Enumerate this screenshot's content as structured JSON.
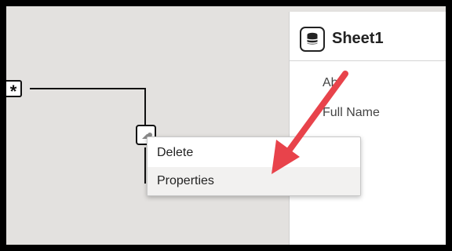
{
  "diagram": {
    "many_marker_symbol": "*",
    "one_marker_icon": "key-icon"
  },
  "table_card": {
    "title": "Sheet1",
    "icon": "database-icon",
    "fields": [
      "Ab",
      "Full Name"
    ]
  },
  "context_menu": {
    "items": [
      "Delete",
      "Properties"
    ],
    "highlighted": "Properties"
  },
  "annotation": {
    "arrow_color": "#e8434b"
  },
  "colors": {
    "canvas": "#e3e1df",
    "frame": "#000000",
    "menu_hover": "#f2f1f0"
  }
}
